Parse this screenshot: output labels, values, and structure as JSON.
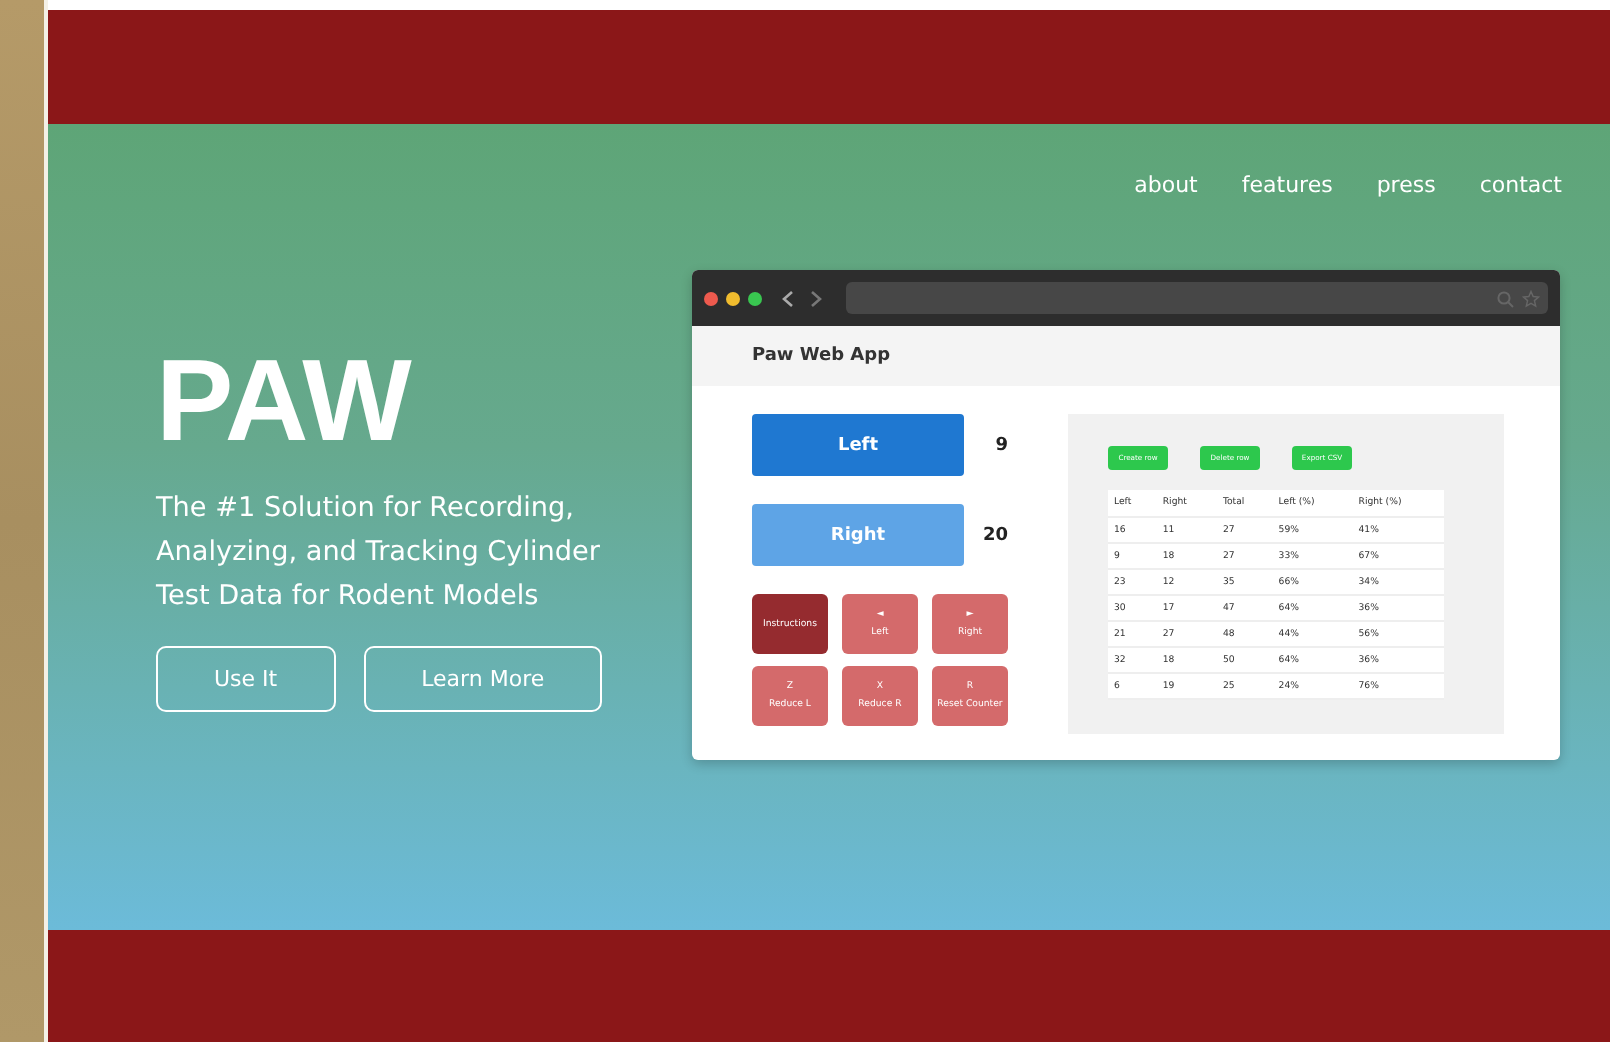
{
  "nav": [
    "about",
    "features",
    "press",
    "contact"
  ],
  "hero": {
    "title": "PAW",
    "tagline": "The #1 Solution for Recording, Analyzing, and Tracking Cylinder Test Data for Rodent Models",
    "buttons": [
      "Use It",
      "Learn More"
    ]
  },
  "mockup": {
    "app_title": "Paw Web App",
    "counters": [
      {
        "label": "Left",
        "count": "9",
        "kind": "primary"
      },
      {
        "label": "Right",
        "count": "20",
        "kind": "secondary"
      }
    ],
    "keys": [
      {
        "label": "Instructions",
        "kind": "dark"
      },
      {
        "key": "◄",
        "label": "Left",
        "kind": "key"
      },
      {
        "key": "►",
        "label": "Right",
        "kind": "key"
      },
      {
        "key": "Z",
        "label": "Reduce L",
        "kind": "key"
      },
      {
        "key": "X",
        "label": "Reduce R",
        "kind": "key"
      },
      {
        "key": "R",
        "label": "Reset Counter",
        "kind": "key"
      }
    ],
    "actions": [
      "Create row",
      "Delete row",
      "Export CSV"
    ],
    "columns": [
      "Left",
      "Right",
      "Total",
      "Left (%)",
      "Right (%)"
    ],
    "rows": [
      [
        "16",
        "11",
        "27",
        "59%",
        "41%"
      ],
      [
        "9",
        "18",
        "27",
        "33%",
        "67%"
      ],
      [
        "23",
        "12",
        "35",
        "66%",
        "34%"
      ],
      [
        "30",
        "17",
        "47",
        "64%",
        "36%"
      ],
      [
        "21",
        "27",
        "48",
        "44%",
        "56%"
      ],
      [
        "32",
        "18",
        "50",
        "64%",
        "36%"
      ],
      [
        "6",
        "19",
        "25",
        "24%",
        "76%"
      ]
    ]
  }
}
